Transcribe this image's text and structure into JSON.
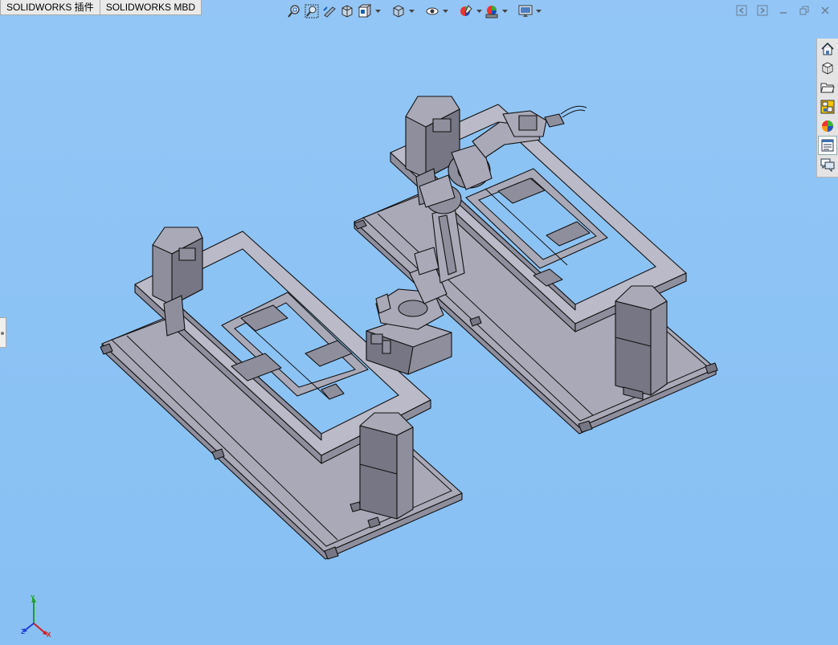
{
  "tabs": [
    {
      "label": "SOLIDWORKS 插件"
    },
    {
      "label": "SOLIDWORKS MBD"
    }
  ],
  "heads_up_toolbar": [
    {
      "name": "zoom-to-fit",
      "icon": "zoom-to-fit-icon"
    },
    {
      "name": "zoom-to-area",
      "icon": "zoom-to-area-icon"
    },
    {
      "name": "previous-view",
      "icon": "previous-view-icon"
    },
    {
      "name": "section-view",
      "icon": "section-view-icon"
    },
    {
      "name": "view-orientation",
      "icon": "view-orientation-icon"
    },
    {
      "name": "display-style",
      "icon": "display-style-icon"
    },
    {
      "name": "hide-show-items",
      "icon": "hide-show-icon"
    },
    {
      "name": "edit-appearance",
      "icon": "edit-appearance-icon"
    },
    {
      "name": "apply-scene",
      "icon": "apply-scene-icon"
    },
    {
      "name": "view-settings",
      "icon": "monitor-icon"
    }
  ],
  "task_pane": [
    {
      "name": "solidworks-resources",
      "icon": "home-icon"
    },
    {
      "name": "design-library",
      "icon": "design-library-icon"
    },
    {
      "name": "file-explorer",
      "icon": "folder-icon"
    },
    {
      "name": "view-palette",
      "icon": "view-palette-icon"
    },
    {
      "name": "appearances-scenes-decals",
      "icon": "appearance-ball-icon"
    },
    {
      "name": "custom-properties",
      "icon": "custom-properties-icon",
      "selected": true
    },
    {
      "name": "solidworks-forum",
      "icon": "forum-icon"
    }
  ],
  "triad": {
    "x": "X",
    "y": "Y",
    "z": "Z"
  },
  "colors": {
    "background": "#8cc3f5",
    "part_face": "#a9a9b8",
    "part_shadow": "#7e7e8c",
    "edge": "#111111",
    "triad_x": "#d21e1e",
    "triad_y": "#1aa31a",
    "triad_z": "#1e3cd2"
  }
}
